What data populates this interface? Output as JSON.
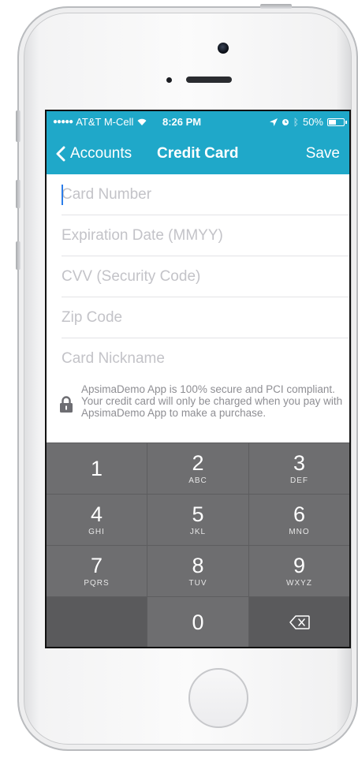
{
  "status_bar": {
    "carrier": "AT&T M-Cell",
    "time": "8:26 PM",
    "battery": "50%",
    "battery_level": 0.5
  },
  "nav": {
    "back_label": "Accounts",
    "title": "Credit Card",
    "save_label": "Save"
  },
  "form": {
    "card_number_placeholder": "Card Number",
    "expiration_placeholder": "Expiration Date (MMYY)",
    "cvv_placeholder": "CVV (Security Code)",
    "zip_placeholder": "Zip Code",
    "nickname_placeholder": "Card Nickname",
    "secure_note": "ApsimaDemo App is 100% secure and PCI compliant.  Your credit card will only be charged when you pay with ApsimaDemo App to make a purchase."
  },
  "keypad": {
    "keys": [
      {
        "num": "1",
        "letters": ""
      },
      {
        "num": "2",
        "letters": "ABC"
      },
      {
        "num": "3",
        "letters": "DEF"
      },
      {
        "num": "4",
        "letters": "GHI"
      },
      {
        "num": "5",
        "letters": "JKL"
      },
      {
        "num": "6",
        "letters": "MNO"
      },
      {
        "num": "7",
        "letters": "PQRS"
      },
      {
        "num": "8",
        "letters": "TUV"
      },
      {
        "num": "9",
        "letters": "WXYZ"
      },
      {
        "num": "0",
        "letters": ""
      }
    ]
  },
  "colors": {
    "accent": "#1fa8c9",
    "keypad_bg": "#5d5d5f",
    "key_bg": "#6e6e70"
  }
}
